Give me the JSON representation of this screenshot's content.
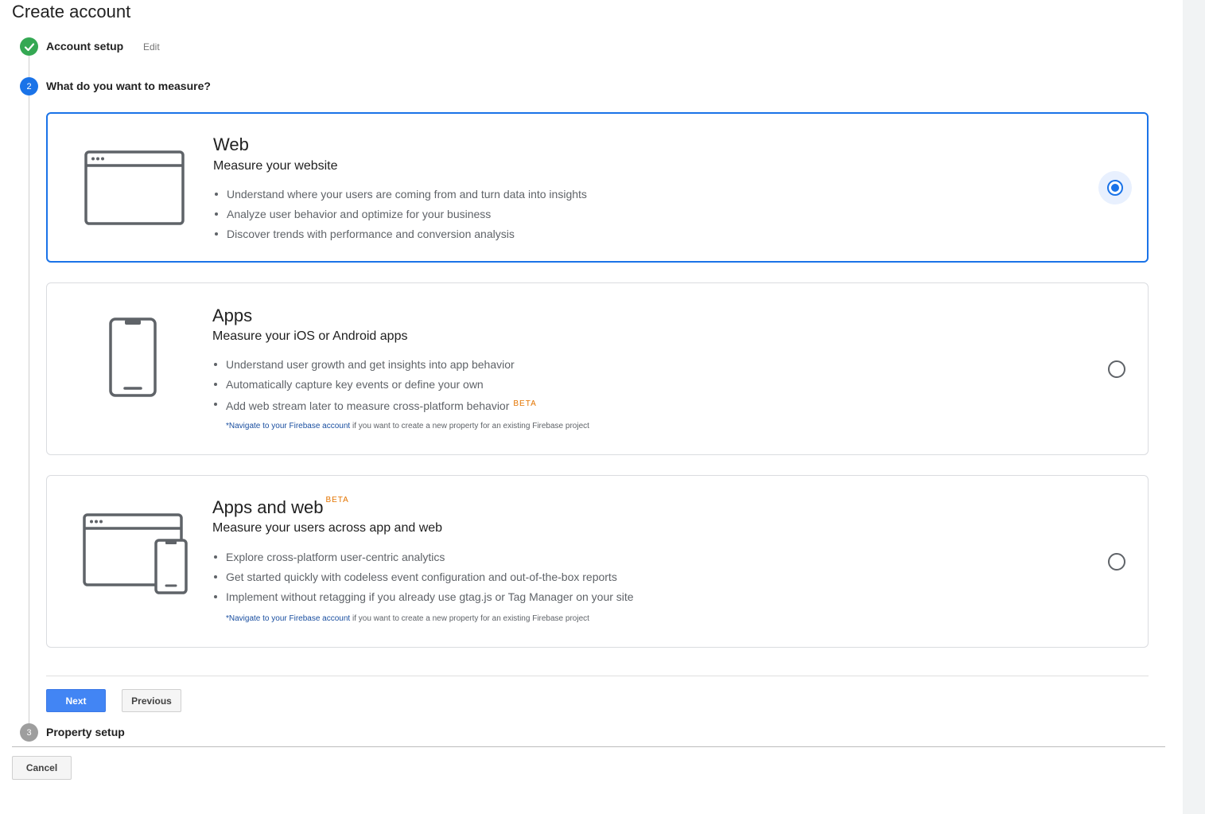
{
  "page": {
    "title": "Create account"
  },
  "steps": [
    {
      "number": "",
      "label": "Account setup",
      "status": "complete",
      "edit_label": "Edit"
    },
    {
      "number": "2",
      "label": "What do you want to measure?",
      "status": "active"
    },
    {
      "number": "3",
      "label": "Property setup",
      "status": "pending"
    }
  ],
  "options": {
    "web": {
      "title": "Web",
      "subtitle": "Measure your website",
      "bullets": [
        "Understand where your users are coming from and turn data into insights",
        "Analyze user behavior and optimize for your business",
        "Discover trends with performance and conversion analysis"
      ],
      "selected": true,
      "icon": "browser-window-icon"
    },
    "apps": {
      "title": "Apps",
      "subtitle": "Measure your iOS or Android apps",
      "bullets": [
        "Understand user growth and get insights into app behavior",
        "Automatically capture key events or define your own",
        "Add web stream later to measure cross-platform behavior"
      ],
      "bullet_badge": "BETA",
      "note_link": "*Navigate to your Firebase account",
      "note_text": " if you want to create a new property for an existing Firebase project",
      "selected": false,
      "icon": "smartphone-icon"
    },
    "apps_and_web": {
      "title": "Apps and web",
      "title_badge": "BETA",
      "subtitle": "Measure your users across app and web",
      "bullets": [
        "Explore cross-platform user-centric analytics",
        "Get started quickly with codeless event configuration and out-of-the-box reports",
        "Implement without retagging if you already use gtag.js or Tag Manager on your site"
      ],
      "note_link": "*Navigate to your Firebase account",
      "note_text": " if you want to create a new property for an existing Firebase project",
      "selected": false,
      "icon": "browser-and-phone-icon"
    }
  },
  "buttons": {
    "next": "Next",
    "previous": "Previous",
    "cancel": "Cancel"
  },
  "colors": {
    "accent": "#1a73e8",
    "primary_button": "#4285f4",
    "success": "#34a853",
    "beta": "#e37400"
  }
}
